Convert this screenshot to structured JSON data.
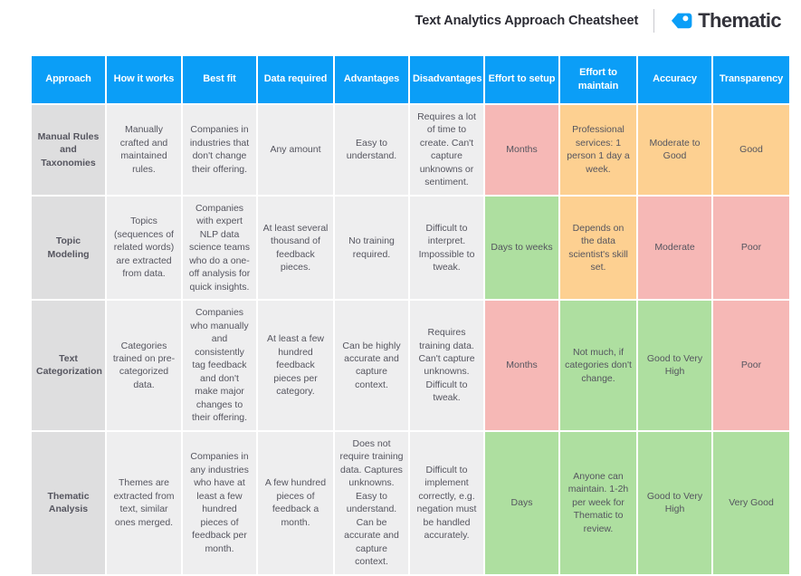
{
  "header": {
    "title": "Text Analytics Approach Cheatsheet",
    "brand_name": "Thematic",
    "brand_icon": "thematic-tag-logo",
    "brand_color": "#0b9ef7"
  },
  "colors": {
    "header_blue": "#0b9ef7",
    "approach_grey": "#dededf",
    "cell_grey": "#eeeeef",
    "red": "#f6b8b6",
    "green": "#aedfa0",
    "orange": "#fdd091",
    "text": "#55555f"
  },
  "table": {
    "columns": [
      "Approach",
      "How it works",
      "Best fit",
      "Data required",
      "Advantages",
      "Disadvantages",
      "Effort to setup",
      "Effort to maintain",
      "Accuracy",
      "Transparency"
    ],
    "rows": [
      {
        "approach": "Manual Rules and Taxonomies",
        "how_it_works": "Manually crafted and maintained rules.",
        "best_fit": "Companies in industries that don't change their offering.",
        "data_required": "Any amount",
        "advantages": "Easy to understand.",
        "disadvantages": "Requires a lot of time to create. Can't capture unknowns or sentiment.",
        "effort_to_setup": "Months",
        "effort_to_maintain": "Professional services: 1 person 1 day a week.",
        "accuracy": "Moderate to Good",
        "transparency": "Good",
        "ratings": {
          "effort_to_setup": "red",
          "effort_to_maintain": "orange",
          "accuracy": "orange",
          "transparency": "orange"
        }
      },
      {
        "approach": "Topic Modeling",
        "how_it_works": "Topics (sequences of related words) are extracted from data.",
        "best_fit": "Companies with expert NLP data science teams who do a one-off analysis for quick insights.",
        "data_required": "At least several thousand of feedback pieces.",
        "advantages": "No training required.",
        "disadvantages": "Difficult to interpret. Impossible to tweak.",
        "effort_to_setup": "Days to weeks",
        "effort_to_maintain": "Depends on the data scientist's skill set.",
        "accuracy": "Moderate",
        "transparency": "Poor",
        "ratings": {
          "effort_to_setup": "green",
          "effort_to_maintain": "orange",
          "accuracy": "red",
          "transparency": "red"
        }
      },
      {
        "approach": "Text Categorization",
        "how_it_works": "Categories trained on pre-categorized data.",
        "best_fit": "Companies who manually and consistently tag feedback and don't make major changes to their offering.",
        "data_required": "At least a few hundred feedback pieces per category.",
        "advantages": "Can be highly accurate and capture context.",
        "disadvantages": "Requires training data. Can't capture unknowns. Difficult to tweak.",
        "effort_to_setup": "Months",
        "effort_to_maintain": "Not much, if categories don't change.",
        "accuracy": "Good to Very High",
        "transparency": "Poor",
        "ratings": {
          "effort_to_setup": "red",
          "effort_to_maintain": "green",
          "accuracy": "green",
          "transparency": "red"
        }
      },
      {
        "approach": "Thematic Analysis",
        "how_it_works": "Themes are extracted from text, similar ones merged.",
        "best_fit": "Companies in any industries who have at least a few hundred pieces of feedback per month.",
        "data_required": "A few hundred pieces of feedback a month.",
        "advantages": "Does not require training data. Captures unknowns. Easy to understand. Can be accurate and capture context.",
        "disadvantages": "Difficult to implement correctly, e.g. negation must be handled accurately.",
        "effort_to_setup": "Days",
        "effort_to_maintain": "Anyone can maintain. 1-2h per week for Thematic to review.",
        "accuracy": "Good to Very High",
        "transparency": "Very Good",
        "ratings": {
          "effort_to_setup": "green",
          "effort_to_maintain": "green",
          "accuracy": "green",
          "transparency": "green"
        }
      }
    ]
  }
}
